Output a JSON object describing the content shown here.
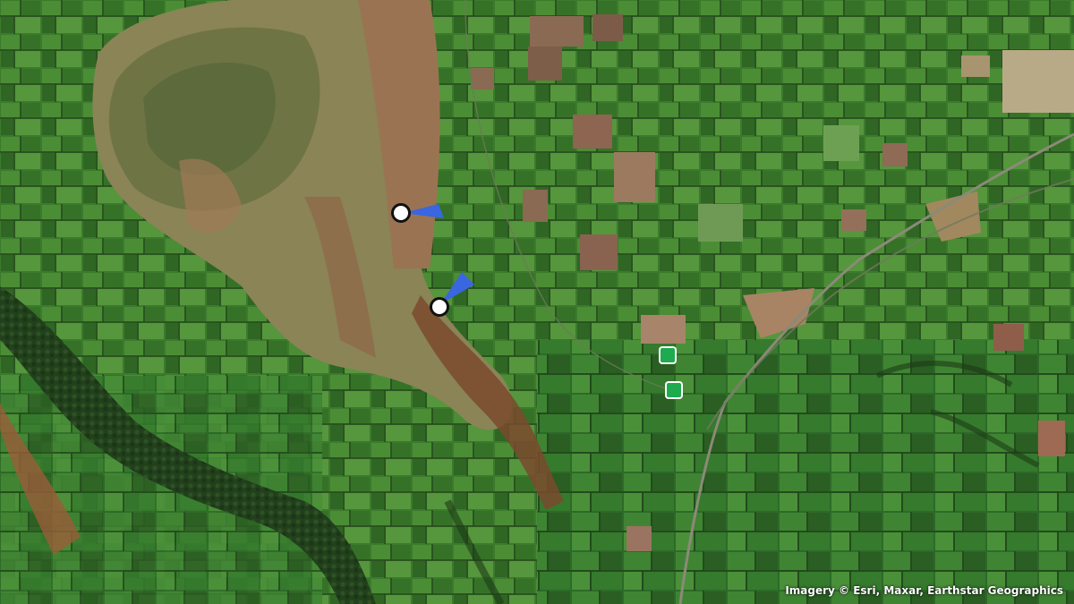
{
  "map": {
    "basemap": "satellite imagery",
    "attribution": "Imagery © Esri, Maxar, Earthstar Geographics",
    "markers": [
      {
        "type": "camera-viewpoint",
        "icon": "viewpoint-circle-icon",
        "heading": "east",
        "color": "#ffffff",
        "cone_color": "#3a66e0"
      },
      {
        "type": "camera-viewpoint",
        "icon": "viewpoint-circle-icon",
        "heading": "north-east",
        "color": "#ffffff",
        "cone_color": "#3a66e0"
      },
      {
        "type": "site",
        "icon": "site-square-icon",
        "color": "#1eaa4e"
      },
      {
        "type": "site",
        "icon": "site-square-icon",
        "color": "#1eaa4e"
      }
    ]
  }
}
